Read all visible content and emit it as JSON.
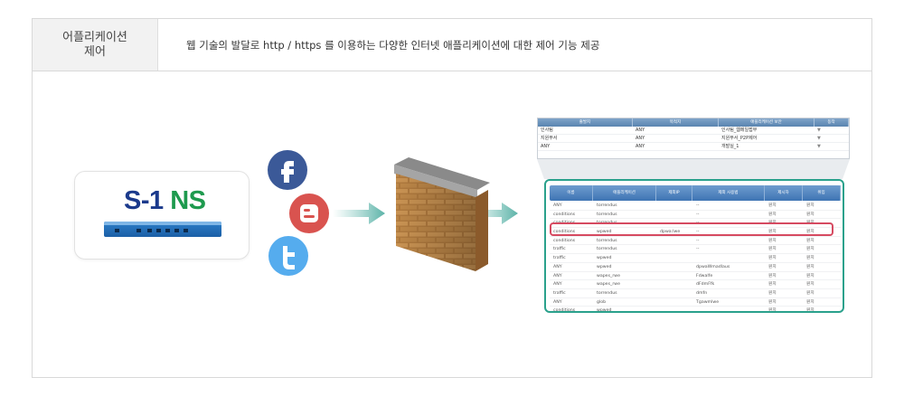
{
  "header": {
    "label": "어플리케이션\n제어",
    "description": "웹 기술의 발달로 http / https 를 이용하는 다양한 인터넷 애플리케이션에 대한 제어 기능 제공"
  },
  "brand": {
    "part1": "S-1",
    "part2": "NS"
  },
  "icons": [
    "facebook-icon",
    "blogger-icon",
    "twitter-icon",
    "arrow-right-icon",
    "firewall-icon"
  ],
  "colors": {
    "accent_teal": "#2aa18c",
    "highlight_red": "#d64a61",
    "facebook": "#3b5998",
    "blogger": "#d9534f",
    "twitter": "#55acee"
  },
  "policy_top": {
    "headers": [
      "출발지",
      "목적지",
      "애플리케이션 보안",
      "동작"
    ],
    "rows": [
      [
        "인사팀",
        "ANY",
        "인사팀_웹메일접부"
      ],
      [
        "지원부서",
        "ANY",
        "지원부서_P2P제어"
      ],
      [
        "ANY",
        "ANY",
        "개발실_1"
      ]
    ]
  },
  "policy_main": {
    "headers": [
      "이름",
      "애플리케이션",
      "제외IP",
      "제외 사용법",
      "제시자",
      "위입"
    ],
    "rows": [
      [
        "ANY",
        "torrendus",
        "",
        "--",
        "원치",
        "원치"
      ],
      [
        "conditions",
        "torrendus",
        "",
        "--",
        "원치",
        "원치"
      ],
      [
        "conditions",
        "torrendus",
        "",
        "--",
        "원치",
        "원치"
      ],
      [
        "conditions",
        "wpwed",
        "dpwa:lwe",
        "--",
        "원치",
        "원치"
      ],
      [
        "conditions",
        "torrendus",
        "",
        "--",
        "원치",
        "원치"
      ],
      [
        "traffic",
        "torrendus",
        "",
        "--",
        "원치",
        "원치"
      ],
      [
        "traffic",
        "wpwed",
        "",
        "",
        "원치",
        "원치"
      ],
      [
        "ANY",
        "wpwed",
        "",
        "dpwaWmadlaus",
        "원치",
        "원치"
      ],
      [
        "ANY",
        "wapes_rwe",
        "",
        "Fdwalfe",
        "원치",
        "원치"
      ],
      [
        "ANY",
        "wapes_rwe",
        "",
        "dFdmFfk",
        "원치",
        "원치"
      ],
      [
        "traffic",
        "torrendus",
        "",
        "dmfn",
        "원치",
        "원치"
      ],
      [
        "ANY",
        "glob",
        "",
        "Tgawmlwe",
        "원치",
        "원치"
      ],
      [
        "conditions",
        "wpwed",
        "",
        "",
        "원치",
        "원치"
      ]
    ]
  }
}
